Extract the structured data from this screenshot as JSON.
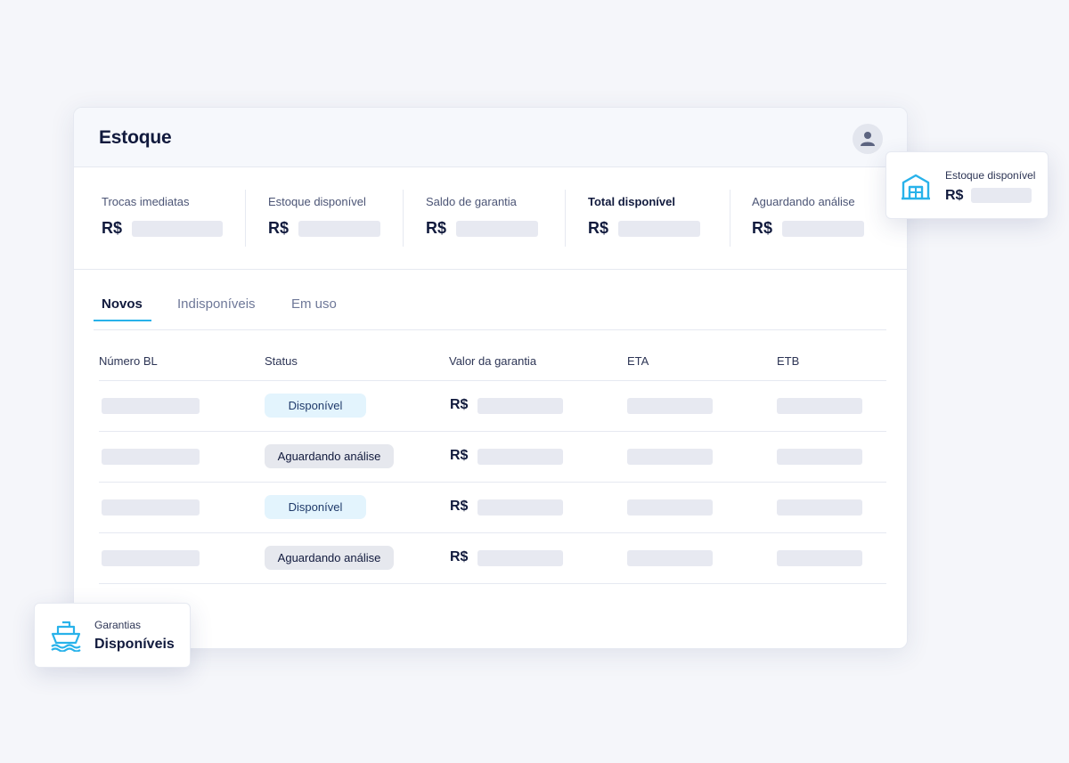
{
  "header": {
    "title": "Estoque",
    "avatar_icon": "user-icon"
  },
  "summary": [
    {
      "label": "Trocas imediatas",
      "currency": "R$",
      "emphasis": false
    },
    {
      "label": "Estoque disponível",
      "currency": "R$",
      "emphasis": false
    },
    {
      "label": "Saldo de garantia",
      "currency": "R$",
      "emphasis": false
    },
    {
      "label": "Total disponível",
      "currency": "R$",
      "emphasis": true
    },
    {
      "label": "Aguardando análise",
      "currency": "R$",
      "emphasis": false
    }
  ],
  "tabs": [
    {
      "label": "Novos",
      "active": true
    },
    {
      "label": "Indisponíveis",
      "active": false
    },
    {
      "label": "Em uso",
      "active": false
    }
  ],
  "table": {
    "columns": [
      "Número BL",
      "Status",
      "Valor da garantia",
      "ETA",
      "ETB"
    ],
    "rows": [
      {
        "status": "Disponível",
        "status_type": "available",
        "currency": "R$"
      },
      {
        "status": "Aguardando análise",
        "status_type": "pending",
        "currency": "R$"
      },
      {
        "status": "Disponível",
        "status_type": "available",
        "currency": "R$"
      },
      {
        "status": "Aguardando análise",
        "status_type": "pending",
        "currency": "R$"
      }
    ]
  },
  "floating_stock": {
    "label": "Estoque disponível",
    "currency": "R$",
    "icon": "warehouse-icon"
  },
  "floating_guarantee": {
    "label": "Garantias",
    "value": "Disponíveis",
    "icon": "ship-icon"
  },
  "colors": {
    "accent": "#28b2ea",
    "text_primary": "#111a3d",
    "badge_available_bg": "#e3f4fd",
    "badge_pending_bg": "#e6e8ee",
    "skeleton": "#e7e9f1"
  }
}
